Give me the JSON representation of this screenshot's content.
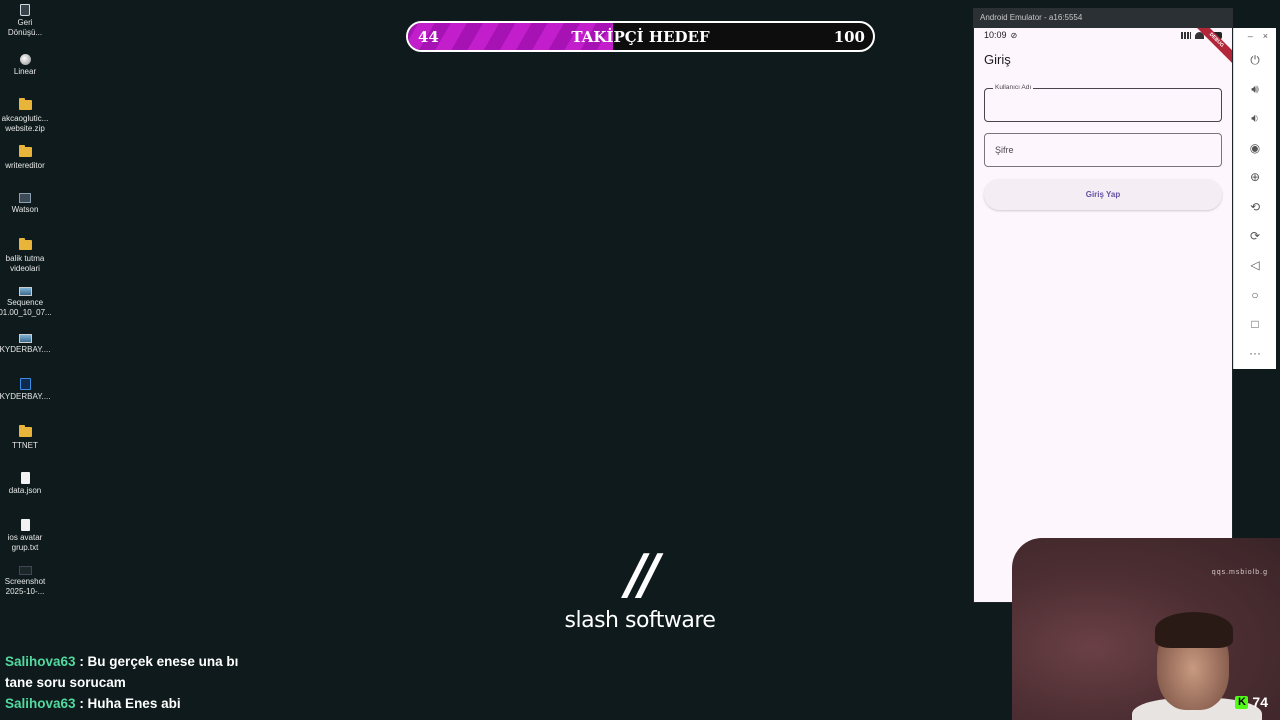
{
  "desktop": {
    "icons": [
      {
        "label": "Geri Dönüşü...",
        "icon": "recycle-bin-icon"
      },
      {
        "label": "Linear",
        "icon": "linear-app-icon"
      },
      {
        "label": "akcaoglutic... website.zip",
        "icon": "zip-folder-icon"
      },
      {
        "label": "writereditor",
        "icon": "folder-icon"
      },
      {
        "label": "Watson",
        "icon": "app-icon"
      },
      {
        "label": "balik tutma videolari",
        "icon": "folder-icon"
      },
      {
        "label": "Sequence 01.00_10_07...",
        "icon": "image-file-icon"
      },
      {
        "label": "KYDERBAY....",
        "icon": "image-file-icon"
      },
      {
        "label": "KYDERBAY....",
        "icon": "photoshop-file-icon"
      },
      {
        "label": "TTNET",
        "icon": "folder-icon"
      },
      {
        "label": "data.json",
        "icon": "file-icon"
      },
      {
        "label": "ios avatar grup.txt",
        "icon": "text-file-icon"
      },
      {
        "label": "Screenshot 2025-10-...",
        "icon": "image-file-icon"
      }
    ]
  },
  "goal": {
    "current": "44",
    "title": "TAKİPÇİ HEDEF",
    "target": "100",
    "progress": 0.44,
    "fill_color": "#c21ecc"
  },
  "logo": {
    "mark": "//",
    "text": "slash software"
  },
  "chat": {
    "messages": [
      {
        "user": "Salihova63",
        "text": ": Bu gerçek enese una bı tane soru sorucam"
      },
      {
        "user": "Salihova63",
        "text": ": Huha Enes abi"
      }
    ]
  },
  "emulator": {
    "window_title": "Android Emulator - a16:5554",
    "status_time": "10:09",
    "debug_label": "DEBUG",
    "app_title": "Giriş",
    "username_label": "Kullanıcı Adı",
    "password_placeholder": "Şifre",
    "login_button": "Giriş Yap",
    "toolbar": [
      "power-icon",
      "volume-up-icon",
      "volume-down-icon",
      "camera-icon",
      "zoom-icon",
      "rotate-left-icon",
      "rotate-right-icon",
      "back-icon",
      "home-icon",
      "overview-icon",
      "more-icon"
    ]
  },
  "webcam": {
    "mirror_text": "qqs.msbiolb.g",
    "viewer_count": "74",
    "platform_icon": "kick-logo-icon",
    "accent": "#53fc18"
  }
}
